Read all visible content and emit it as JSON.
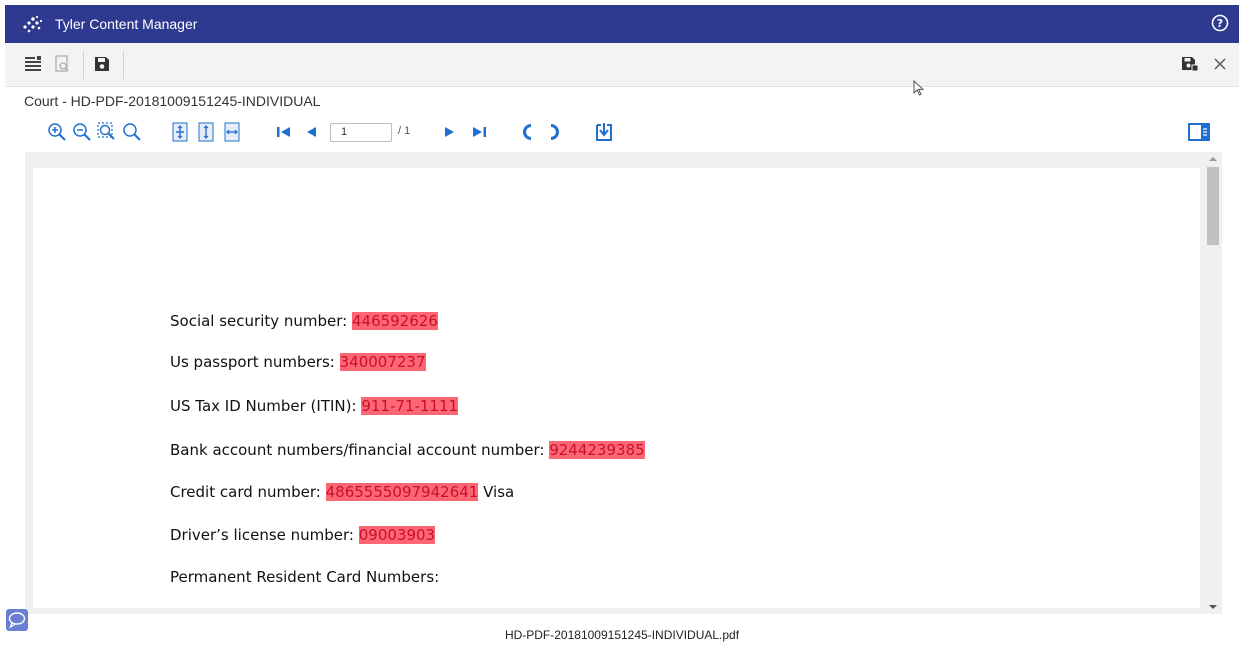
{
  "app": {
    "title": "Tyler Content Manager"
  },
  "document": {
    "title": "Court - HD-PDF-20181009151245-INDIVIDUAL",
    "filename": "HD-PDF-20181009151245-INDIVIDUAL.pdf"
  },
  "viewer": {
    "page_current": "1",
    "page_total": "/ 1"
  },
  "pdf_lines": [
    {
      "label": "Social security number: ",
      "value": "446592626",
      "suffix": ""
    },
    {
      "label": "Us passport numbers: ",
      "value": "340007237",
      "suffix": ""
    },
    {
      "label": "US Tax ID Number (ITIN): ",
      "value": "911-71-1111",
      "suffix": ""
    },
    {
      "label": "Bank account numbers/financial account number: ",
      "value": "9244239385",
      "suffix": ""
    },
    {
      "label": "Credit card number:  ",
      "value": "4865555097942641",
      "suffix": " Visa"
    },
    {
      "label": "Driver’s license number: ",
      "value": "09003903",
      "suffix": ""
    },
    {
      "label": "Permanent Resident Card Numbers:",
      "value": "",
      "suffix": ""
    }
  ],
  "colors": {
    "titlebar": "#2e3a8f",
    "highlight": "#ff6673",
    "viewer_accent": "#1f6fd1"
  }
}
